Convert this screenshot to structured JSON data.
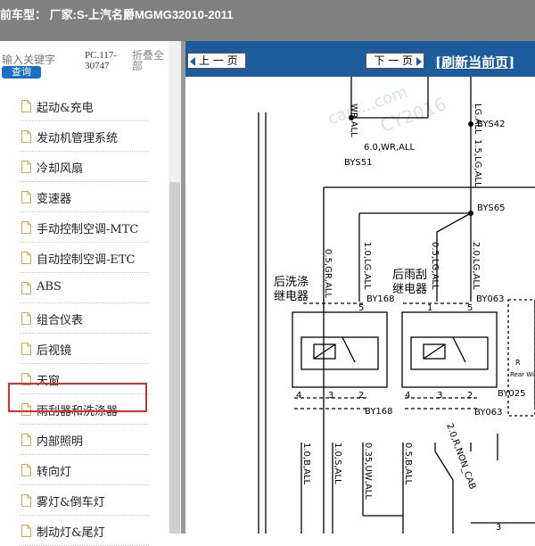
{
  "header": {
    "title": "前车型：  厂家:S-上汽名爵MGMG32010-2011"
  },
  "search": {
    "placeholder": "输入关键字",
    "button_label": "查询"
  },
  "pc": {
    "line1": "PC.117-",
    "line2": "30747"
  },
  "fold": {
    "label": "折叠全部"
  },
  "tree": {
    "items": [
      {
        "label": "起动&充电"
      },
      {
        "label": "发动机管理系统"
      },
      {
        "label": "冷却风扇"
      },
      {
        "label": "变速器"
      },
      {
        "label": "手动控制空调-MTC"
      },
      {
        "label": "自动控制空调-ETC"
      },
      {
        "label": "ABS"
      },
      {
        "label": "组合仪表"
      },
      {
        "label": "后视镜"
      },
      {
        "label": "天窗"
      },
      {
        "label": "雨刮器和洗涤器"
      },
      {
        "label": "内部照明"
      },
      {
        "label": "转向灯"
      },
      {
        "label": "雾灯&倒车灯"
      },
      {
        "label": "制动灯&尾灯"
      }
    ],
    "selected": "雨刮器和洗涤器"
  },
  "nav": {
    "prev_label": "上 一 页",
    "next_label": "下 一 页",
    "refresh_label": "[刷新当前页]"
  },
  "diagram": {
    "watermark1": "cars...com",
    "watermark2": "CY2016",
    "labels": {
      "wr_all_top": "WR.ALL",
      "wire_60": "6.0,WR,ALL",
      "bys51": "BYS51",
      "lg_all_top": "LG.ALL",
      "bys42": "BYS42",
      "wire_15lg": "1.5,LG,ALL",
      "bys65": "BYS65",
      "wire_05gr": "0.5,GR,ALL",
      "wire_10lg": "1.0,LG,ALL",
      "wire_05lg": "0.5,LG,ALL",
      "wire_20lg": "2.0,LG,ALL",
      "relay1_a": "后洗涤",
      "relay1_b": "继电器",
      "relay2_a": "后雨刮",
      "relay2_b": "继电器",
      "by168_top": "BY168",
      "by063_top": "BY063",
      "pin1": "1",
      "pin5a": "5",
      "pin5b": "5",
      "pin4a": "4",
      "pin3a": "3",
      "pin2a": "2",
      "pin4b": "4",
      "pin3b": "3",
      "pin2b": "2",
      "by168_bot": "BY168",
      "by063_bot": "BY063",
      "by025": "BY025",
      "r_label": "R",
      "rear_wip": "Rear Wip",
      "wire_10b": "1.0,B,ALL",
      "wire_10s": "1.0,S,ALL",
      "wire_035uw": "0.35,UW,ALL",
      "wire_05b": "0.5,B,ALL",
      "wire_20r": "2.0,R,NON_CAB",
      "pin3c": "3"
    }
  }
}
